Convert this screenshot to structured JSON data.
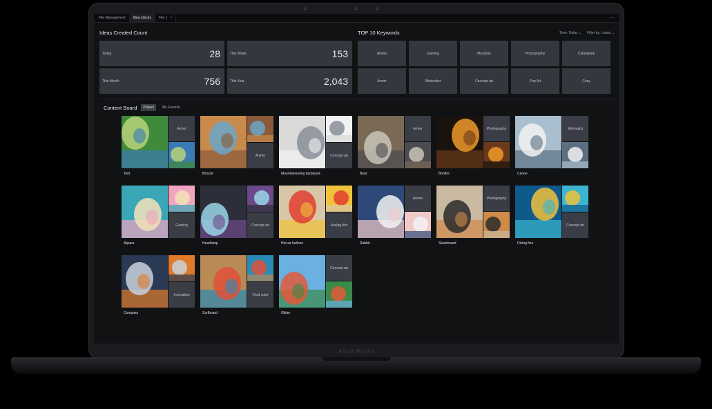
{
  "tabs": [
    {
      "label": "File Management"
    },
    {
      "label": "Idea Library"
    },
    {
      "label": "File 1"
    }
  ],
  "tab_close": "×",
  "more": "⋯",
  "ideas": {
    "title": "Ideas Created Count",
    "stats": [
      {
        "label": "Today",
        "value": "28"
      },
      {
        "label": "This Week",
        "value": "153"
      },
      {
        "label": "This Month",
        "value": "756"
      },
      {
        "label": "This Year",
        "value": "2,043"
      }
    ]
  },
  "keywords": {
    "title": "TOP 10 Keywords",
    "filters": [
      "Time: Today ⌄",
      "Filter by: Latest ⌄"
    ],
    "items": [
      "Anime",
      "Gaming",
      "Musician",
      "Photography",
      "Cyberpunk",
      "Armor",
      "Minimalist",
      "Concept art",
      "Pop Art",
      "Cozy"
    ]
  },
  "content_board": {
    "title": "Content Board",
    "tabs": [
      "Project",
      "My Favorite"
    ],
    "cards": [
      {
        "name": "Tent",
        "tag": "Armor",
        "colors": [
          "#3f8a3b",
          "#b9d27a",
          "#3b7bb5"
        ]
      },
      {
        "name": "Bicycle",
        "tag": "Anime",
        "colors": [
          "#c98b4c",
          "#6aa6c9",
          "#8a5a3a"
        ]
      },
      {
        "name": "Mountaineering backpack",
        "tag": "Concept art",
        "colors": [
          "#d9d9d9",
          "#8a8f99",
          "#f2f2f2"
        ]
      },
      {
        "name": "Bear",
        "tag": "Armor",
        "colors": [
          "#7a6a55",
          "#c9c4b8",
          "#4b4b50"
        ]
      },
      {
        "name": "Bonfire",
        "tag": "Photography",
        "colors": [
          "#1a120c",
          "#f09a2a",
          "#6b3a1a"
        ]
      },
      {
        "name": "Canoe",
        "tag": "Minimalist",
        "colors": [
          "#a9bfd0",
          "#f2f2f2",
          "#5b6f80"
        ]
      },
      {
        "name": "Alpaca",
        "tag": "Gaming",
        "colors": [
          "#39a7b8",
          "#f3e2b8",
          "#f2a3c0"
        ]
      },
      {
        "name": "Headlamp",
        "tag": "Concept art",
        "colors": [
          "#2c2f3a",
          "#9ad6e6",
          "#6c4a8a"
        ]
      },
      {
        "name": "Hot air balloon",
        "tag": "Analog film",
        "colors": [
          "#d8c7a6",
          "#e23d2f",
          "#f0c23b"
        ]
      },
      {
        "name": "Rabbit",
        "tag": "Anime",
        "colors": [
          "#2f4a7a",
          "#f2f2f2",
          "#f2c9c9"
        ]
      },
      {
        "name": "Skateboard",
        "tag": "Photography",
        "colors": [
          "#c9b9a0",
          "#2a2a2a",
          "#d08a4a"
        ]
      },
      {
        "name": "Diving fins",
        "tag": "Concept art",
        "colors": [
          "#0f5a8a",
          "#f0c23b",
          "#3bb5d0"
        ]
      },
      {
        "name": "Compass",
        "tag": "Innovation",
        "colors": [
          "#2a3a55",
          "#c9d2dd",
          "#e07a2a"
        ]
      },
      {
        "name": "Surfboard",
        "tag": "Vivid color",
        "colors": [
          "#b98a55",
          "#e0503a",
          "#2a8ab5"
        ]
      },
      {
        "name": "Glider",
        "tag": "Concept art",
        "colors": [
          "#6ab0e0",
          "#e05a3a",
          "#3a8a4a"
        ]
      }
    ]
  },
  "brand": "ASUS ProArt"
}
